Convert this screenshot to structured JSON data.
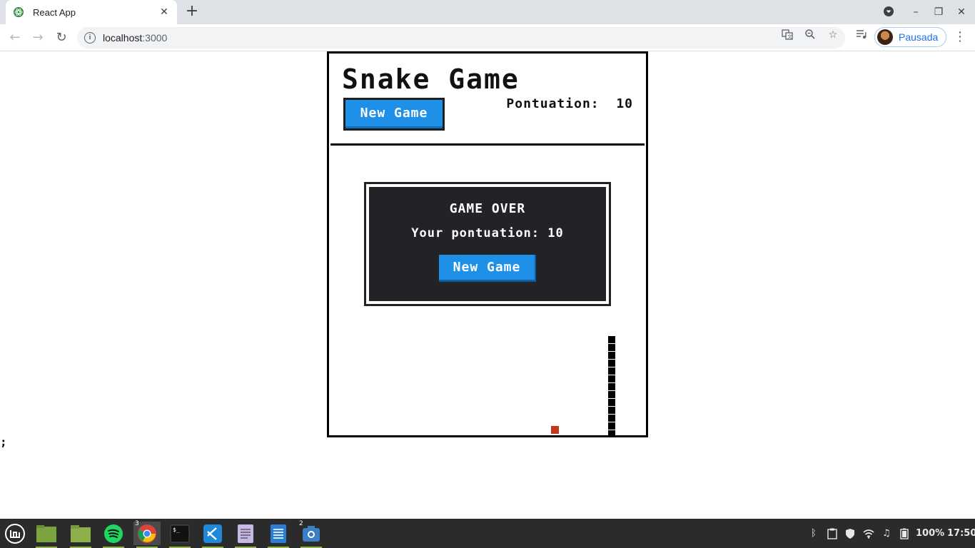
{
  "browser": {
    "tab_title": "React App",
    "url_host": "localhost",
    "url_port": ":3000",
    "profile_name": "Pausada"
  },
  "game": {
    "title": "Snake Game",
    "new_game_label": "New Game",
    "score_label": "Pontuation:",
    "score_value": "10",
    "game_over": {
      "title": "GAME OVER",
      "score_text": "Your pontuation: 10",
      "button_label": "New Game"
    },
    "snake_length": 13,
    "food_color": "#c0391a",
    "button_color": "#1e90e8"
  },
  "page_stray_text": ";",
  "taskbar": {
    "apps": [
      {
        "name": "menu",
        "badge": ""
      },
      {
        "name": "files-green",
        "badge": ""
      },
      {
        "name": "folder",
        "badge": ""
      },
      {
        "name": "spotify",
        "badge": ""
      },
      {
        "name": "chrome",
        "badge": "3"
      },
      {
        "name": "terminal",
        "badge": ""
      },
      {
        "name": "vscode",
        "badge": ""
      },
      {
        "name": "text-editor",
        "badge": ""
      },
      {
        "name": "libreoffice-writer",
        "badge": ""
      },
      {
        "name": "screenshot",
        "badge": "2"
      }
    ],
    "battery": "100%",
    "clock": "17:50"
  }
}
